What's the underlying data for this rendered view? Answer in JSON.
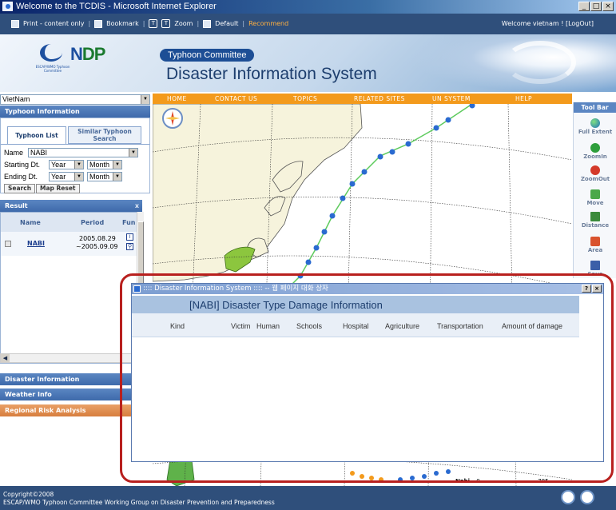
{
  "window": {
    "title": "Welcome to the TCDIS - Microsoft Internet Explorer",
    "buttons": [
      "_",
      "□",
      "×"
    ]
  },
  "topbar": {
    "links": [
      "Print - content only",
      "Bookmark",
      "Zoom",
      "Default",
      "Recommend"
    ],
    "zoom_glyphs": [
      "T",
      "T"
    ],
    "separator": "|",
    "welcome": "Welcome vietnam ! [LogOut]"
  },
  "header": {
    "escap_logo_text": "ESCAP/WMO Typhoon Committee",
    "ndp_logo_text": "NDP",
    "committee_pill": "Typhoon Committee",
    "title": "Disaster Information System"
  },
  "nav": {
    "items": [
      "HOME",
      "CONTACT US",
      "TOPICS",
      "RELATED SITES",
      "UN SYSTEM",
      "HELP"
    ]
  },
  "left": {
    "country_select": "VietNam",
    "typhoon_info_header": "Typhoon Information",
    "tabs": [
      "Typhoon List",
      "Similar Typhoon Search"
    ],
    "name_label": "Name",
    "name_value": "NABI",
    "starting_label": "Starting Dt.",
    "ending_label": "Ending Dt.",
    "year_option": "Year",
    "month_option": "Month",
    "search_button": "Search",
    "map_reset_button": "Map Reset",
    "result_header": "Result",
    "result_close": "x",
    "result_columns": [
      "Name",
      "Period",
      "Fun"
    ],
    "result_row": {
      "name": "NABI",
      "period_start": "2005.08.29",
      "period_end": "~2005.09.09"
    },
    "sections": [
      "Disaster Information",
      "Weather Info",
      "Regional Risk Analysis"
    ]
  },
  "toolbar": {
    "header": "Tool Bar",
    "tools": [
      "Full Extent",
      "ZoomIn",
      "ZoomOut",
      "Move",
      "Distance",
      "Area",
      "Save"
    ]
  },
  "popup": {
    "window_title": ":::: Disaster Information System :::: -- 웹 페이지 대화 상자",
    "window_buttons": [
      "?",
      "×"
    ],
    "heading": "[NABI] Disaster Type Damage Information",
    "columns": [
      "Kind",
      "Victim",
      "Human",
      "Schools",
      "Hospital",
      "Agriculture",
      "Transportation",
      "Amount of damage"
    ]
  },
  "map": {
    "scale_label": "0",
    "scale_value": "785",
    "legend_label": "Nabi"
  },
  "footer": {
    "copyright": "Copyright©2008",
    "org": "ESCAP/WMO Typhoon Committee Working Group on Disaster Prevention and Preparedness"
  },
  "colors": {
    "nav_orange": "#f39a1c",
    "header_blue": "#2f4f7b",
    "section_blue": "#4a77b8",
    "regional_orange": "#d98a4f",
    "highlight_red": "#b8201e",
    "track_blue": "#2a6ad0",
    "track_green": "#5ecb5e"
  }
}
